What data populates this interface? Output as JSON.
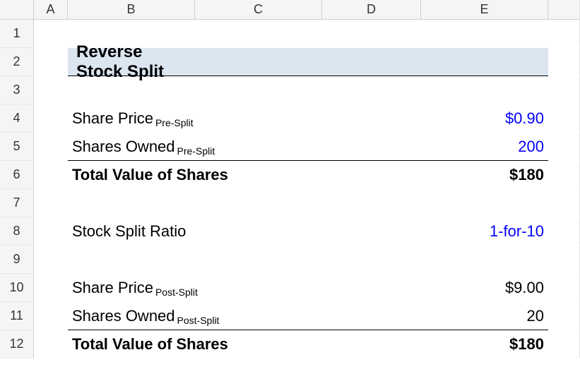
{
  "columns": [
    "A",
    "B",
    "C",
    "D",
    "E"
  ],
  "rows": [
    "1",
    "2",
    "3",
    "4",
    "5",
    "6",
    "7",
    "8",
    "9",
    "10",
    "11",
    "12"
  ],
  "title": "Reverse Stock Split",
  "labels": {
    "share_price": "Share Price",
    "shares_owned": "Shares Owned",
    "total_value": "Total Value of Shares",
    "split_ratio": "Stock Split Ratio",
    "pre_split": "Pre-Split",
    "post_split": "Post-Split"
  },
  "values": {
    "price_pre": "$0.90",
    "shares_pre": "200",
    "total_pre": "$180",
    "ratio": "1-for-10",
    "price_post": "$9.00",
    "shares_post": "20",
    "total_post": "$180"
  },
  "chart_data": {
    "type": "table",
    "title": "Reverse Stock Split",
    "rows": [
      {
        "label": "Share Price Pre-Split",
        "value": 0.9,
        "display": "$0.90"
      },
      {
        "label": "Shares Owned Pre-Split",
        "value": 200,
        "display": "200"
      },
      {
        "label": "Total Value of Shares",
        "value": 180,
        "display": "$180"
      },
      {
        "label": "Stock Split Ratio",
        "value": "1-for-10",
        "display": "1-for-10"
      },
      {
        "label": "Share Price Post-Split",
        "value": 9.0,
        "display": "$9.00"
      },
      {
        "label": "Shares Owned Post-Split",
        "value": 20,
        "display": "20"
      },
      {
        "label": "Total Value of Shares",
        "value": 180,
        "display": "$180"
      }
    ]
  }
}
